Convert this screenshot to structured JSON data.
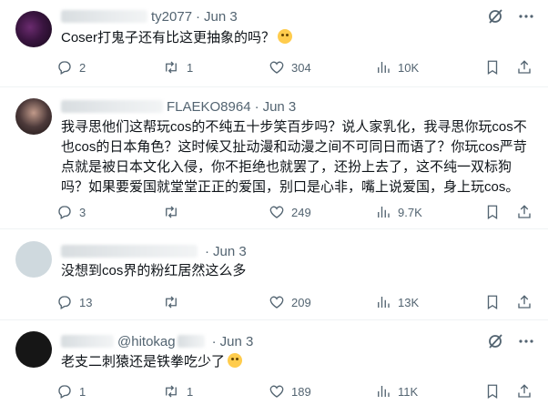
{
  "tweets": [
    {
      "handle": "ty2077",
      "date": "Jun 3",
      "text": "Coser打鬼子还有比这更抽象的吗？",
      "emoji": "sweat-smile",
      "replies": "2",
      "retweets": "1",
      "likes": "304",
      "views": "10K"
    },
    {
      "handle": "FLAEKO8964",
      "date": "Jun 3",
      "text": "我寻思他们这帮玩cos的不纯五十步笑百步吗？说人家乳化，我寻思你玩cos不也cos的日本角色？这时候又扯动漫和动漫之间不可同日而语了？你玩cos严苛点就是被日本文化入侵，你不拒绝也就罢了，还扮上去了，这不纯一双标狗吗？如果要爱国就堂堂正正的爱国，别口是心非，嘴上说爱国，身上玩cos。",
      "replies": "3",
      "retweets": "",
      "likes": "249",
      "views": "9.7K"
    },
    {
      "handle": "",
      "date": "Jun 3",
      "text": "没想到cos界的粉红居然这么多",
      "replies": "13",
      "retweets": "",
      "likes": "209",
      "views": "13K"
    },
    {
      "handle": "@hitokag",
      "date": "Jun 3",
      "text": "老支二刺猿还是铁拳吃少了",
      "emoji": "rofl",
      "replies": "1",
      "retweets": "1",
      "likes": "189",
      "views": "11K"
    }
  ],
  "icons": {
    "grok": "grok-icon",
    "more": "more-icon",
    "reply": "reply-icon",
    "retweet": "retweet-icon",
    "like": "heart-icon",
    "views": "views-icon",
    "bookmark": "bookmark-icon",
    "share": "share-icon"
  },
  "colors": {
    "text": "#0f1419",
    "muted": "#536471",
    "divider": "#eff3f4",
    "emoji": "#ffcc4d"
  }
}
